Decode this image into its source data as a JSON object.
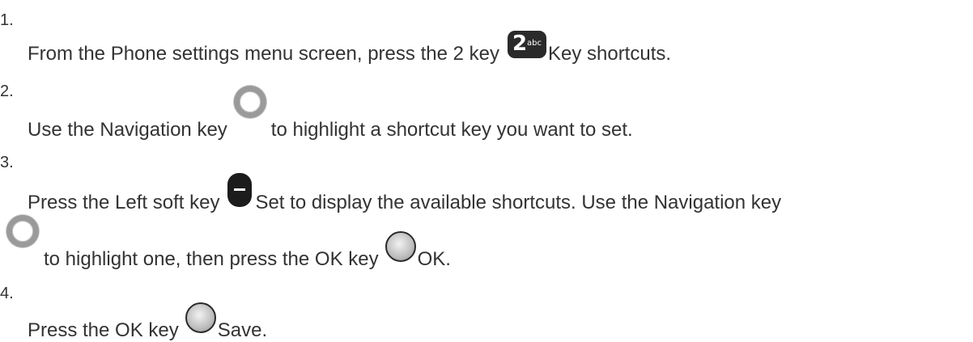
{
  "steps": [
    {
      "number": "1.",
      "lines": [
        {
          "before": "From the Phone settings menu screen, press the 2 key",
          "icon": "key-2abc-icon",
          "after": "Key shortcuts."
        }
      ]
    },
    {
      "number": "2.",
      "lines": [
        {
          "before": "Use the Navigation key",
          "icon": "navigation-key-icon",
          "after": "to highlight a shortcut key you want to set."
        }
      ]
    },
    {
      "number": "3.",
      "lines": [
        {
          "before": "Press the Left soft key",
          "icon": "left-soft-key-icon",
          "after": "Set to display the available shortcuts. Use the Navigation key"
        },
        {
          "before": "",
          "icon": "navigation-key-icon",
          "after": "to highlight one, then press the OK key",
          "icon2": "ok-key-icon",
          "after2": "OK."
        }
      ]
    },
    {
      "number": "4.",
      "lines": [
        {
          "before": "Press the OK key",
          "icon": "ok-key-icon",
          "after": "Save."
        }
      ]
    }
  ],
  "key2_glyph": {
    "big": "2",
    "small": "abc"
  }
}
